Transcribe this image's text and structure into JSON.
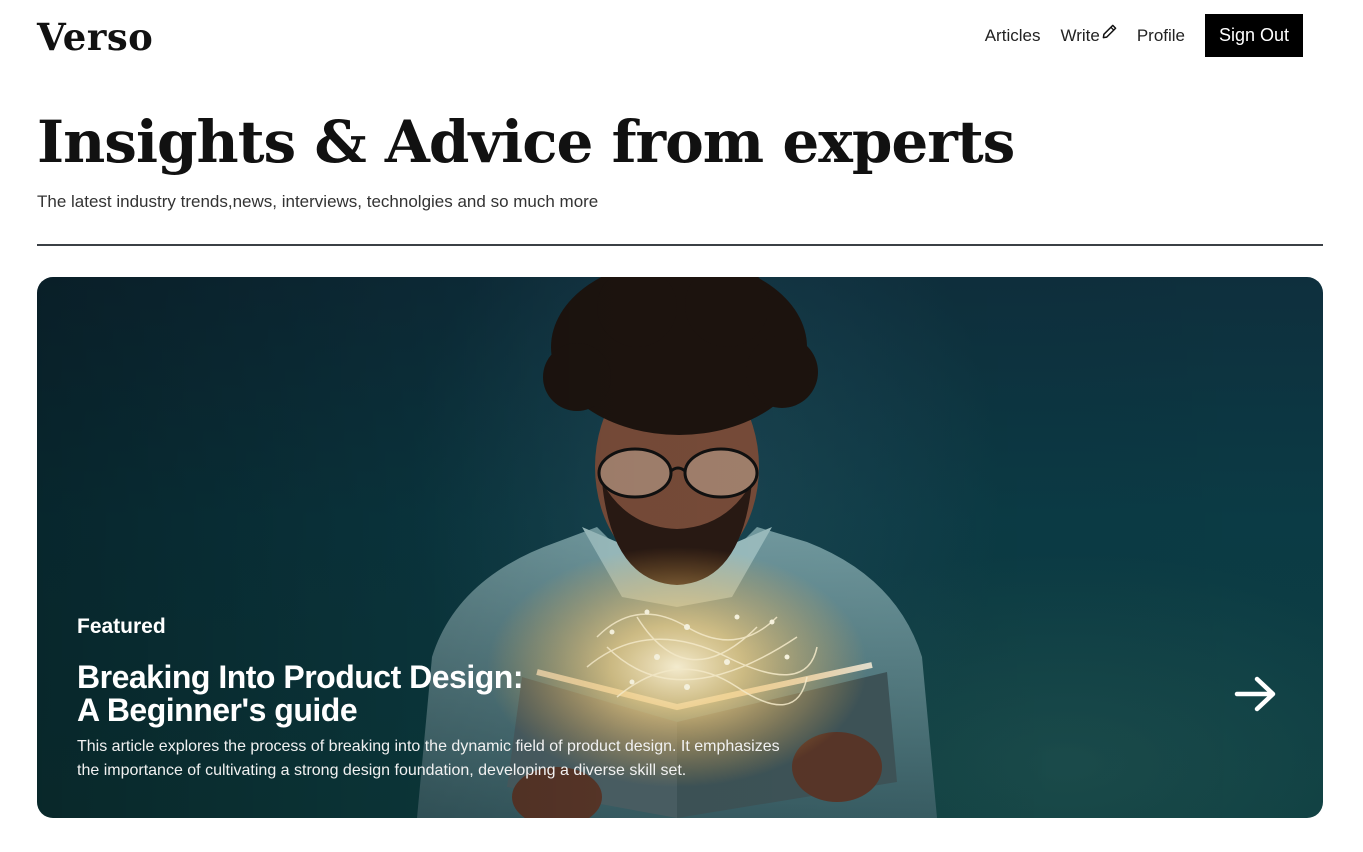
{
  "brand": {
    "logo": "Verso"
  },
  "nav": {
    "articles": "Articles",
    "write": "Write",
    "write_icon": "pencil-icon",
    "profile": "Profile",
    "sign_out": "Sign Out"
  },
  "hero": {
    "title": "Insights & Advice from experts",
    "subtitle": "The latest industry trends,news, interviews, technolgies and so much more"
  },
  "featured": {
    "tag": "Featured",
    "title_line1": "Breaking Into Product Design:",
    "title_line2": "A Beginner's guide",
    "description": "This article explores the process of breaking into the dynamic field of product design. It emphasizes the importance of cultivating a strong design foundation, developing a diverse skill set.",
    "arrow_icon": "arrow-right-icon",
    "image_icon": "reading-person-photo"
  },
  "colors": {
    "primary": "#000000",
    "card_bg": "#0d3440",
    "text": "#111111"
  }
}
